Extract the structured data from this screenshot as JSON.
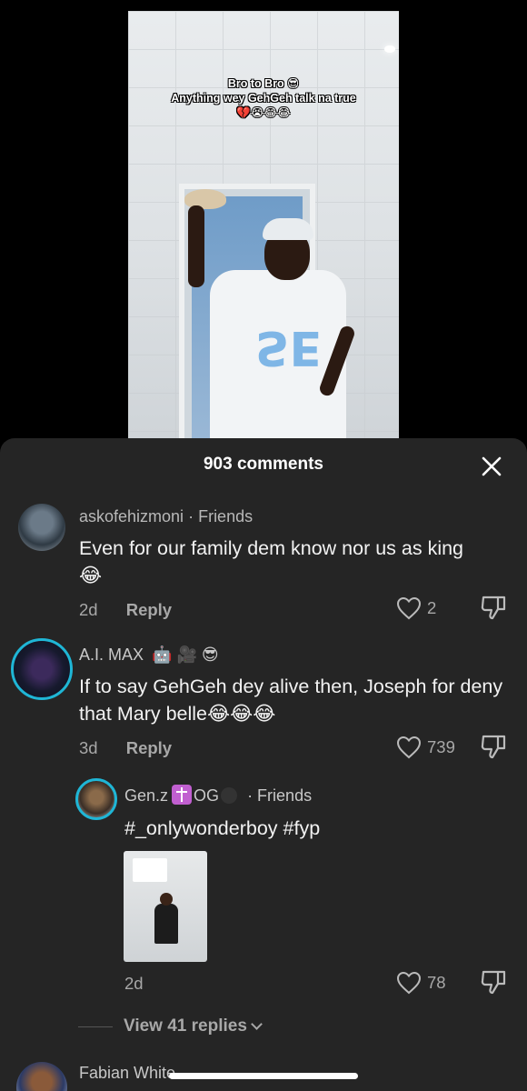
{
  "video": {
    "caption_line1": "Bro to Bro 😎",
    "caption_line2": "Anything wey GehGeh talk na true",
    "caption_line3": "💔😭😂😂",
    "jersey_text": "SE"
  },
  "comments_panel": {
    "title": "903 comments",
    "reply_label": "Reply",
    "view_replies": "View 41 replies"
  },
  "comments": [
    {
      "username": "askofehizmoni",
      "tag": "· Friends",
      "text": "Even for our family dem know nor us as king",
      "emoji": "😂",
      "age": "2d",
      "likes": "2"
    },
    {
      "username": "A.I. MAX",
      "badges": "🤖 🎥 😎",
      "text": "If to say GehGeh dey alive then, Joseph for deny that Mary belle",
      "emoji": "😂😂😂",
      "age": "3d",
      "likes": "739"
    },
    {
      "username": "Gen.z",
      "username_suffix": "OG",
      "tag": "· Friends",
      "text": "#_onlywonderboy #fyp",
      "age": "2d",
      "likes": "78"
    },
    {
      "username": "Fabian White"
    }
  ],
  "colors": {
    "sheet_bg": "#252525",
    "accent_ring": "#1fb6d6"
  }
}
